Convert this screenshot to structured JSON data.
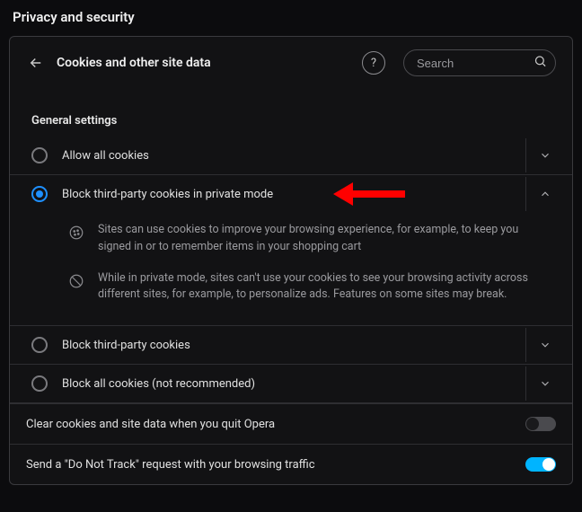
{
  "page": {
    "title": "Privacy and security"
  },
  "panel": {
    "heading": "Cookies and other site data",
    "search_placeholder": "Search"
  },
  "section": {
    "title": "General settings"
  },
  "options": {
    "0": {
      "label": "Allow all cookies",
      "selected": false,
      "expanded": false
    },
    "1": {
      "label": "Block third-party cookies in private mode",
      "selected": true,
      "expanded": true,
      "detail_a": "Sites can use cookies to improve your browsing experience, for example, to keep you signed in or to remember items in your shopping cart",
      "detail_b": "While in private mode, sites can't use your cookies to see your browsing activity across different sites, for example, to personalize ads. Features on some sites may break."
    },
    "2": {
      "label": "Block third-party cookies",
      "selected": false,
      "expanded": false
    },
    "3": {
      "label": "Block all cookies (not recommended)",
      "selected": false,
      "expanded": false
    }
  },
  "toggles": {
    "clear_on_quit": {
      "label": "Clear cookies and site data when you quit Opera",
      "on": false
    },
    "dnt": {
      "label": "Send a \"Do Not Track\" request with your browsing traffic",
      "on": true
    }
  },
  "annotation": {
    "visible": true,
    "color": "#ff0000"
  }
}
